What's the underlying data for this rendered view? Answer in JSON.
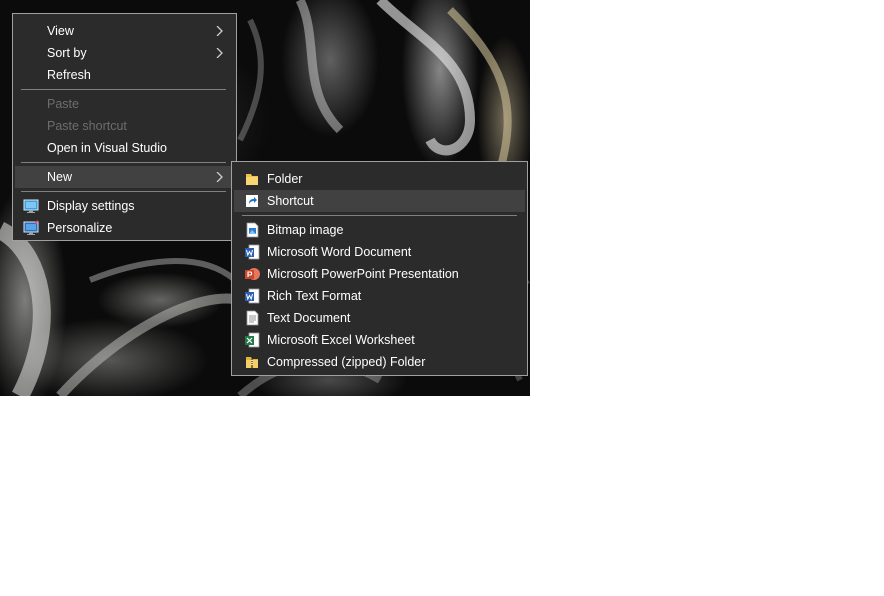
{
  "context_menu": {
    "items": [
      {
        "label": "View"
      },
      {
        "label": "Sort by"
      },
      {
        "label": "Refresh"
      },
      {
        "label": "Paste"
      },
      {
        "label": "Paste shortcut"
      },
      {
        "label": "Open in Visual Studio"
      },
      {
        "label": "New"
      },
      {
        "label": "Display settings",
        "icon": "display-settings-icon"
      },
      {
        "label": "Personalize",
        "icon": "personalize-icon"
      }
    ]
  },
  "new_submenu": {
    "items": [
      {
        "label": "Folder",
        "icon": "folder-icon"
      },
      {
        "label": "Shortcut",
        "icon": "shortcut-icon"
      },
      {
        "label": "Bitmap image",
        "icon": "bitmap-image-icon"
      },
      {
        "label": "Microsoft Word Document",
        "icon": "word-document-icon"
      },
      {
        "label": "Microsoft PowerPoint Presentation",
        "icon": "powerpoint-icon"
      },
      {
        "label": "Rich Text Format",
        "icon": "rich-text-icon"
      },
      {
        "label": "Text Document",
        "icon": "text-document-icon"
      },
      {
        "label": "Microsoft Excel Worksheet",
        "icon": "excel-icon"
      },
      {
        "label": "Compressed (zipped) Folder",
        "icon": "zip-folder-icon"
      }
    ]
  },
  "colors": {
    "menu_background": "#2b2b2b",
    "menu_border": "#a0a0a0",
    "highlight": "#414141",
    "text": "#ffffff",
    "disabled_text": "#6d6d6d"
  }
}
